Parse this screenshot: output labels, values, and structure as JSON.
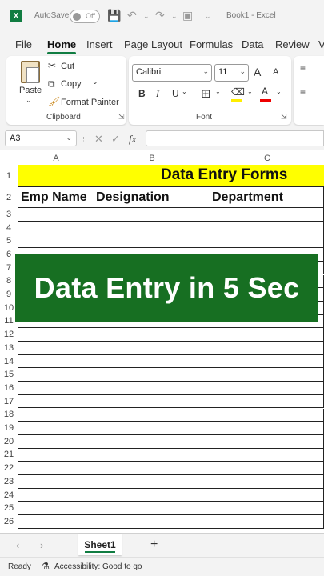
{
  "titlebar": {
    "app_icon": "X",
    "autosave_label": "AutoSave",
    "autosave_state": "Off",
    "document_title": "Book1  -  Excel",
    "icons": [
      "save-icon",
      "undo-icon",
      "redo-icon",
      "camera-icon",
      "more-icon"
    ]
  },
  "ribbon_tabs": [
    "File",
    "Home",
    "Insert",
    "Page Layout",
    "Formulas",
    "Data",
    "Review",
    "V"
  ],
  "active_tab": "Home",
  "clipboard": {
    "paste": "Paste",
    "cut": "Cut",
    "copy": "Copy",
    "format_painter": "Format Painter",
    "group_label": "Clipboard"
  },
  "font": {
    "family": "Calibri",
    "size": "11",
    "group_label": "Font",
    "buttons": {
      "bold": "B",
      "italic": "I",
      "underline": "U",
      "grow": "A",
      "shrink": "A",
      "font_color": "A"
    }
  },
  "formula_bar": {
    "name_box": "A3",
    "fx": "fx",
    "value": ""
  },
  "grid": {
    "columns": [
      "A",
      "B",
      "C"
    ],
    "rows": [
      "1",
      "2",
      "3",
      "4",
      "5",
      "6",
      "7",
      "8",
      "9",
      "10",
      "11",
      "12",
      "13",
      "14",
      "15",
      "16",
      "17",
      "18",
      "19",
      "20",
      "21",
      "22",
      "23",
      "24",
      "25",
      "26"
    ],
    "title_cell": "Data Entry Forms",
    "headers": [
      "Emp Name",
      "Designation",
      "Department"
    ]
  },
  "banner": {
    "text": "Data Entry in 5 Sec"
  },
  "sheets": {
    "tabs": [
      "Sheet1"
    ],
    "add": "+"
  },
  "status": {
    "ready": "Ready",
    "accessibility": "Accessibility: Good to go"
  },
  "colors": {
    "accent_green": "#107c41",
    "title_fill": "#ffff00",
    "banner_green": "#176f22"
  }
}
